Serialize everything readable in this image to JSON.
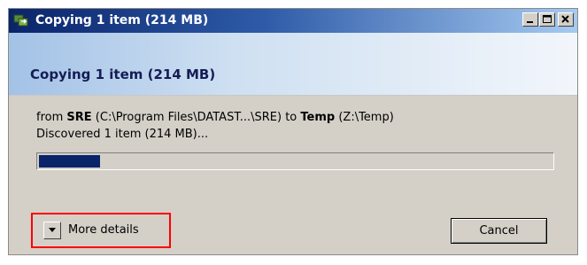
{
  "window": {
    "title": "Copying 1 item (214 MB)",
    "controls": [
      "minimize-icon",
      "maximize-icon",
      "close-icon"
    ]
  },
  "header": {
    "title": "Copying 1 item (214 MB)"
  },
  "transfer": {
    "from_prefix": "from ",
    "source_name": "SRE",
    "source_path": " (C:\\Program Files\\DATAST...\\SRE) to ",
    "dest_name": "Temp",
    "dest_path": " (Z:\\Temp)",
    "discovered": "Discovered 1 item (214 MB)..."
  },
  "progress": {
    "fraction": 0.12,
    "color": "#0a246a"
  },
  "footer": {
    "more_details_label": "More details",
    "cancel_label": "Cancel",
    "highlight_color": "#ff0000"
  }
}
